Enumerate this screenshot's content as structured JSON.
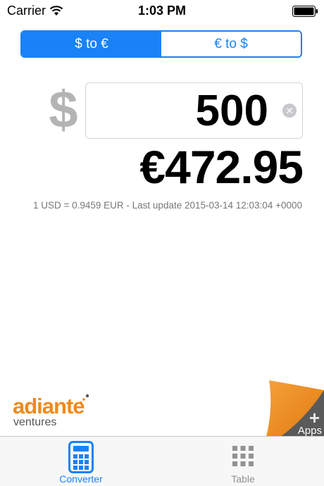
{
  "status_bar": {
    "carrier": "Carrier",
    "time": "1:03 PM",
    "icons": [
      "wifi-icon",
      "battery-icon"
    ]
  },
  "segmented": {
    "options": [
      "$ to €",
      "€ to $"
    ],
    "selected_index": 0,
    "accent": "#1a82f7"
  },
  "converter": {
    "from_symbol": "$",
    "amount": "500",
    "result": "€472.95",
    "rate_info": "1 USD = 0.9459 EUR - Last update 2015-03-14 12:03:04 +0000"
  },
  "branding": {
    "logo_main": "adiante",
    "logo_sub": "ventures",
    "logo_color": "#ef8a1a",
    "apps_label": "Apps",
    "apps_plus": "+"
  },
  "tab_bar": {
    "tabs": [
      {
        "label": "Converter",
        "icon": "calculator-icon",
        "selected": true
      },
      {
        "label": "Table",
        "icon": "grid-icon",
        "selected": false
      }
    ]
  }
}
